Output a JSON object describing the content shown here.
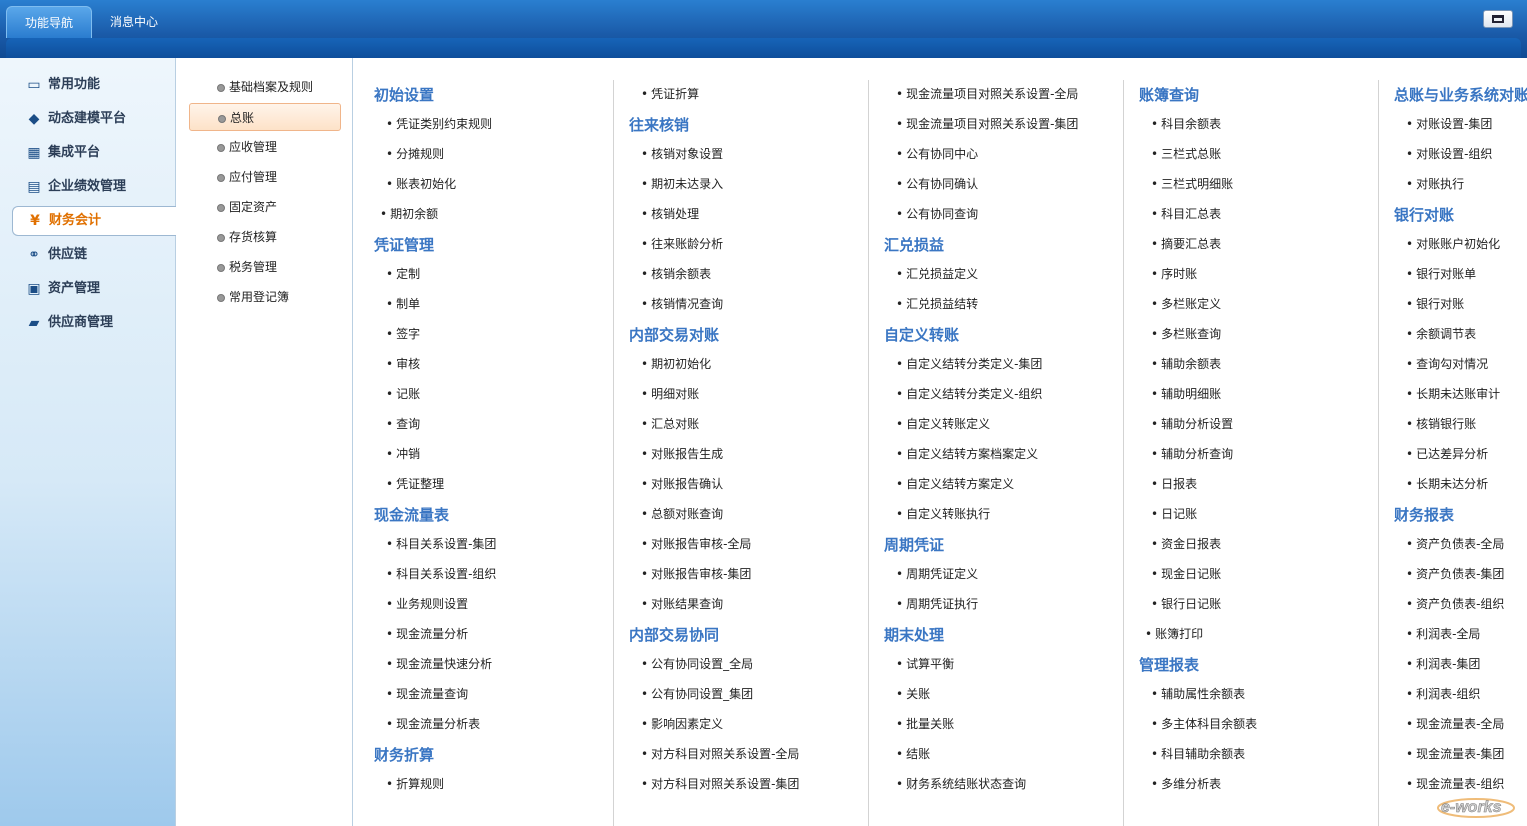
{
  "top_tabs": [
    "功能导航",
    "消息中心"
  ],
  "sidebar": [
    "常用功能",
    "动态建模平台",
    "集成平台",
    "企业绩效管理",
    "财务会计",
    "供应链",
    "资产管理",
    "供应商管理"
  ],
  "sidebar_active": 4,
  "subnav": [
    "基础档案及规则",
    "总账",
    "应收管理",
    "应付管理",
    "固定资产",
    "存货核算",
    "税务管理",
    "常用登记簿"
  ],
  "subnav_active": 1,
  "columns": [
    [
      {
        "t": "cat",
        "v": "初始设置"
      },
      {
        "t": "lnk",
        "v": "凭证类别约束规则"
      },
      {
        "t": "lnk",
        "v": "分摊规则"
      },
      {
        "t": "lnk",
        "v": "账表初始化"
      },
      {
        "t": "lnk0",
        "v": "期初余额"
      },
      {
        "t": "cat",
        "v": "凭证管理"
      },
      {
        "t": "lnk",
        "v": "定制"
      },
      {
        "t": "lnk",
        "v": "制单"
      },
      {
        "t": "lnk",
        "v": "签字"
      },
      {
        "t": "lnk",
        "v": "审核"
      },
      {
        "t": "lnk",
        "v": "记账"
      },
      {
        "t": "lnk",
        "v": "查询"
      },
      {
        "t": "lnk",
        "v": "冲销"
      },
      {
        "t": "lnk",
        "v": "凭证整理"
      },
      {
        "t": "cat",
        "v": "现金流量表"
      },
      {
        "t": "lnk",
        "v": "科目关系设置-集团"
      },
      {
        "t": "lnk",
        "v": "科目关系设置-组织"
      },
      {
        "t": "lnk",
        "v": "业务规则设置"
      },
      {
        "t": "lnk",
        "v": "现金流量分析"
      },
      {
        "t": "lnk",
        "v": "现金流量快速分析"
      },
      {
        "t": "lnk",
        "v": "现金流量查询"
      },
      {
        "t": "lnk",
        "v": "现金流量分析表"
      },
      {
        "t": "cat",
        "v": "财务折算"
      },
      {
        "t": "lnk",
        "v": "折算规则"
      }
    ],
    [
      {
        "t": "lnk",
        "v": "凭证折算"
      },
      {
        "t": "cat",
        "v": "往来核销"
      },
      {
        "t": "lnk",
        "v": "核销对象设置"
      },
      {
        "t": "lnk",
        "v": "期初未达录入"
      },
      {
        "t": "lnk",
        "v": "核销处理"
      },
      {
        "t": "lnk",
        "v": "往来账龄分析"
      },
      {
        "t": "lnk",
        "v": "核销余额表"
      },
      {
        "t": "lnk",
        "v": "核销情况查询"
      },
      {
        "t": "cat",
        "v": "内部交易对账"
      },
      {
        "t": "lnk",
        "v": "期初初始化"
      },
      {
        "t": "lnk",
        "v": "明细对账"
      },
      {
        "t": "lnk",
        "v": "汇总对账"
      },
      {
        "t": "lnk",
        "v": "对账报告生成"
      },
      {
        "t": "lnk",
        "v": "对账报告确认"
      },
      {
        "t": "lnk",
        "v": "总额对账查询"
      },
      {
        "t": "lnk",
        "v": "对账报告审核-全局"
      },
      {
        "t": "lnk",
        "v": "对账报告审核-集团"
      },
      {
        "t": "lnk",
        "v": "对账结果查询"
      },
      {
        "t": "cat",
        "v": "内部交易协同"
      },
      {
        "t": "lnk",
        "v": "公有协同设置_全局"
      },
      {
        "t": "lnk",
        "v": "公有协同设置_集团"
      },
      {
        "t": "lnk",
        "v": "影响因素定义"
      },
      {
        "t": "lnk",
        "v": "对方科目对照关系设置-全局"
      },
      {
        "t": "lnk",
        "v": "对方科目对照关系设置-集团"
      }
    ],
    [
      {
        "t": "lnk",
        "v": "现金流量项目对照关系设置-全局"
      },
      {
        "t": "lnk",
        "v": "现金流量项目对照关系设置-集团"
      },
      {
        "t": "lnk",
        "v": "公有协同中心"
      },
      {
        "t": "lnk",
        "v": "公有协同确认"
      },
      {
        "t": "lnk",
        "v": "公有协同查询"
      },
      {
        "t": "cat",
        "v": "汇兑损益"
      },
      {
        "t": "lnk",
        "v": "汇兑损益定义"
      },
      {
        "t": "lnk",
        "v": "汇兑损益结转"
      },
      {
        "t": "cat",
        "v": "自定义转账"
      },
      {
        "t": "lnk",
        "v": "自定义结转分类定义-集团"
      },
      {
        "t": "lnk",
        "v": "自定义结转分类定义-组织"
      },
      {
        "t": "lnk",
        "v": "自定义转账定义"
      },
      {
        "t": "lnk",
        "v": "自定义结转方案档案定义"
      },
      {
        "t": "lnk",
        "v": "自定义结转方案定义"
      },
      {
        "t": "lnk",
        "v": "自定义转账执行"
      },
      {
        "t": "cat",
        "v": "周期凭证"
      },
      {
        "t": "lnk",
        "v": "周期凭证定义"
      },
      {
        "t": "lnk",
        "v": "周期凭证执行"
      },
      {
        "t": "cat",
        "v": "期末处理"
      },
      {
        "t": "lnk",
        "v": "试算平衡"
      },
      {
        "t": "lnk",
        "v": "关账"
      },
      {
        "t": "lnk",
        "v": "批量关账"
      },
      {
        "t": "lnk",
        "v": "结账"
      },
      {
        "t": "lnk",
        "v": "财务系统结账状态查询"
      }
    ],
    [
      {
        "t": "cat",
        "v": "账簿查询"
      },
      {
        "t": "lnk",
        "v": "科目余额表"
      },
      {
        "t": "lnk",
        "v": "三栏式总账"
      },
      {
        "t": "lnk",
        "v": "三栏式明细账"
      },
      {
        "t": "lnk",
        "v": "科目汇总表"
      },
      {
        "t": "lnk",
        "v": "摘要汇总表"
      },
      {
        "t": "lnk",
        "v": "序时账"
      },
      {
        "t": "lnk",
        "v": "多栏账定义"
      },
      {
        "t": "lnk",
        "v": "多栏账查询"
      },
      {
        "t": "lnk",
        "v": "辅助余额表"
      },
      {
        "t": "lnk",
        "v": "辅助明细账"
      },
      {
        "t": "lnk",
        "v": "辅助分析设置"
      },
      {
        "t": "lnk",
        "v": "辅助分析查询"
      },
      {
        "t": "lnk",
        "v": "日报表"
      },
      {
        "t": "lnk",
        "v": "日记账"
      },
      {
        "t": "lnk",
        "v": "资金日报表"
      },
      {
        "t": "lnk",
        "v": "现金日记账"
      },
      {
        "t": "lnk",
        "v": "银行日记账"
      },
      {
        "t": "lnk0",
        "v": "账簿打印"
      },
      {
        "t": "cat",
        "v": "管理报表"
      },
      {
        "t": "lnk",
        "v": "辅助属性余额表"
      },
      {
        "t": "lnk",
        "v": "多主体科目余额表"
      },
      {
        "t": "lnk",
        "v": "科目辅助余额表"
      },
      {
        "t": "lnk",
        "v": "多维分析表"
      }
    ],
    [
      {
        "t": "cat",
        "v": "总账与业务系统对账"
      },
      {
        "t": "lnk",
        "v": "对账设置-集团"
      },
      {
        "t": "lnk",
        "v": "对账设置-组织"
      },
      {
        "t": "lnk",
        "v": "对账执行"
      },
      {
        "t": "cat",
        "v": "银行对账"
      },
      {
        "t": "lnk",
        "v": "对账账户初始化"
      },
      {
        "t": "lnk",
        "v": "银行对账单"
      },
      {
        "t": "lnk",
        "v": "银行对账"
      },
      {
        "t": "lnk",
        "v": "余额调节表"
      },
      {
        "t": "lnk",
        "v": "查询勾对情况"
      },
      {
        "t": "lnk",
        "v": "长期未达账审计"
      },
      {
        "t": "lnk",
        "v": "核销银行账"
      },
      {
        "t": "lnk",
        "v": "已达差异分析"
      },
      {
        "t": "lnk",
        "v": "长期未达分析"
      },
      {
        "t": "cat",
        "v": "财务报表"
      },
      {
        "t": "lnk",
        "v": "资产负债表-全局"
      },
      {
        "t": "lnk",
        "v": "资产负债表-集团"
      },
      {
        "t": "lnk",
        "v": "资产负债表-组织"
      },
      {
        "t": "lnk",
        "v": "利润表-全局"
      },
      {
        "t": "lnk",
        "v": "利润表-集团"
      },
      {
        "t": "lnk",
        "v": "利润表-组织"
      },
      {
        "t": "lnk",
        "v": "现金流量表-全局"
      },
      {
        "t": "lnk",
        "v": "现金流量表-集团"
      },
      {
        "t": "lnk",
        "v": "现金流量表-组织"
      }
    ]
  ],
  "logo_text": "e-works",
  "colors": {
    "accent": "#3a76c3",
    "active_side": "#e07000",
    "topbar": "#1a5aa8"
  }
}
